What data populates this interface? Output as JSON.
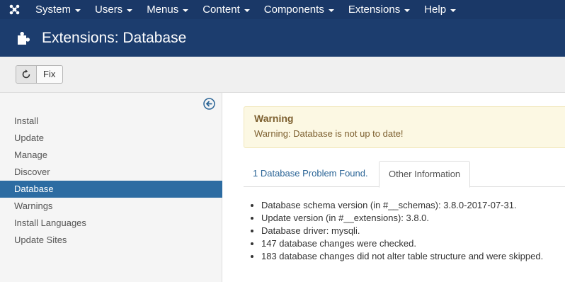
{
  "topnav": {
    "items": [
      {
        "label": "System"
      },
      {
        "label": "Users"
      },
      {
        "label": "Menus"
      },
      {
        "label": "Content"
      },
      {
        "label": "Components"
      },
      {
        "label": "Extensions"
      },
      {
        "label": "Help"
      }
    ]
  },
  "header": {
    "title": "Extensions: Database",
    "icon": "puzzle-piece-icon"
  },
  "toolbar": {
    "fix_label": "Fix",
    "fix_icon": "refresh-icon"
  },
  "sidebar": {
    "collapse_icon": "circle-arrow-left-icon",
    "items": [
      {
        "label": "Install"
      },
      {
        "label": "Update"
      },
      {
        "label": "Manage"
      },
      {
        "label": "Discover"
      },
      {
        "label": "Database"
      },
      {
        "label": "Warnings"
      },
      {
        "label": "Install Languages"
      },
      {
        "label": "Update Sites"
      }
    ],
    "active": "Database"
  },
  "alert": {
    "title": "Warning",
    "message": "Warning: Database is not up to date!"
  },
  "tabs": {
    "problems": "1 Database Problem Found.",
    "other_info": "Other Information",
    "active": "Other Information"
  },
  "info": [
    "Database schema version (in #__schemas): 3.8.0-2017-07-31.",
    "Update version (in #__extensions): 3.8.0.",
    "Database driver: mysqli.",
    "147 database changes were checked.",
    "183 database changes did not alter table structure and were skipped."
  ],
  "colors": {
    "navbar": "#1a3867",
    "header": "#1c3d6e",
    "active_sidebar": "#2d6ca2",
    "warning_bg": "#fcf8e3",
    "warning_text": "#7d6030",
    "link": "#2a6496"
  }
}
